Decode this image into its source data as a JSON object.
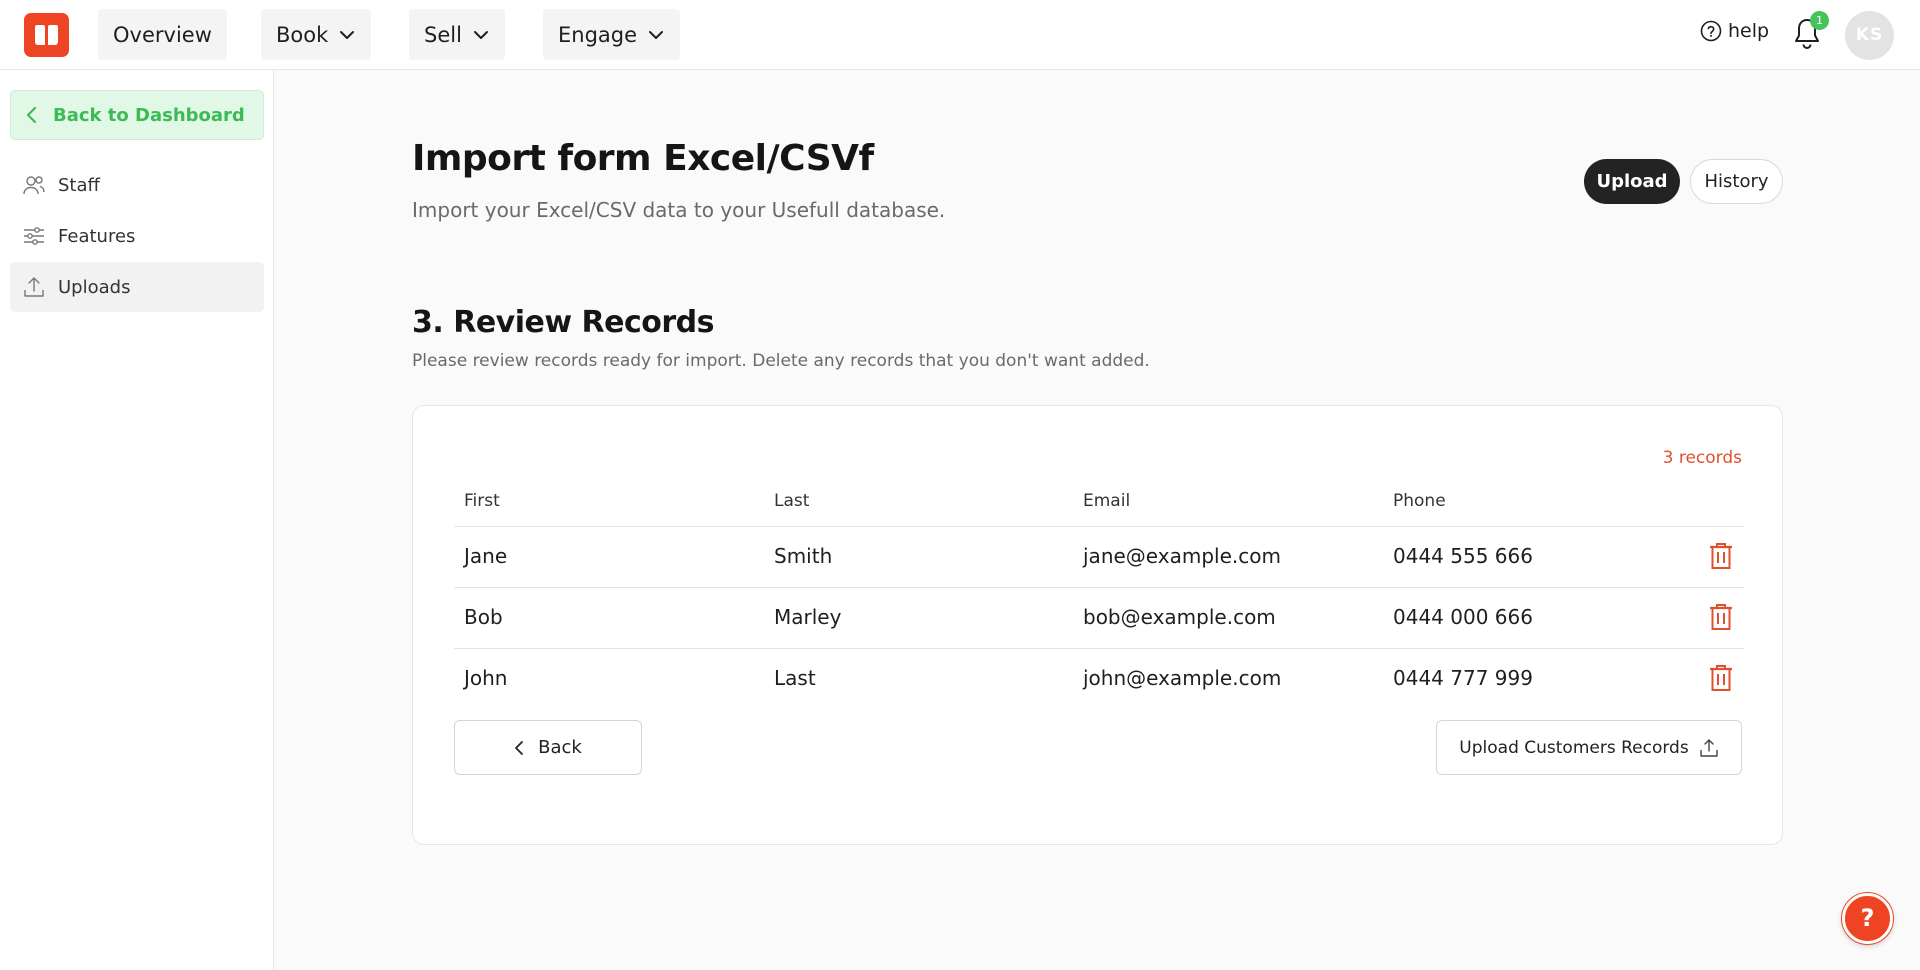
{
  "topbar": {
    "nav": [
      {
        "label": "Overview"
      },
      {
        "label": "Book"
      },
      {
        "label": "Sell"
      },
      {
        "label": "Engage"
      }
    ],
    "help_label": "help",
    "notification_count": "1",
    "avatar_initials": "KS"
  },
  "sidebar": {
    "back_label": "Back to Dashboard",
    "items": [
      {
        "label": "Staff",
        "icon": "users-icon"
      },
      {
        "label": "Features",
        "icon": "sliders-icon"
      },
      {
        "label": "Uploads",
        "icon": "upload-icon",
        "active": true
      }
    ]
  },
  "page": {
    "title": "Import form Excel/CSVf",
    "subtitle": "Import your Excel/CSV data to your Usefull database.",
    "tabs": [
      {
        "label": "Upload",
        "selected": true
      },
      {
        "label": "History",
        "selected": false
      }
    ]
  },
  "section": {
    "title": "3. Review Records",
    "subtitle": "Please review records ready for import. Delete any records that you don't want added."
  },
  "table": {
    "count_label": "3 records",
    "columns": [
      "First",
      "Last",
      "Email",
      "Phone"
    ],
    "rows": [
      {
        "first": "Jane",
        "last": "Smith",
        "email": "jane@example.com",
        "phone": "0444 555 666"
      },
      {
        "first": "Bob",
        "last": "Marley",
        "email": "bob@example.com",
        "phone": "0444 000 666"
      },
      {
        "first": "John",
        "last": "Last",
        "email": "john@example.com",
        "phone": "0444 777 999"
      }
    ]
  },
  "actions": {
    "back_label": "Back",
    "upload_label": "Upload Customers Records"
  },
  "fab_label": "?",
  "colors": {
    "brand": "#ef4423",
    "success": "#3cba56",
    "danger": "#e0502f",
    "dark": "#232323"
  }
}
